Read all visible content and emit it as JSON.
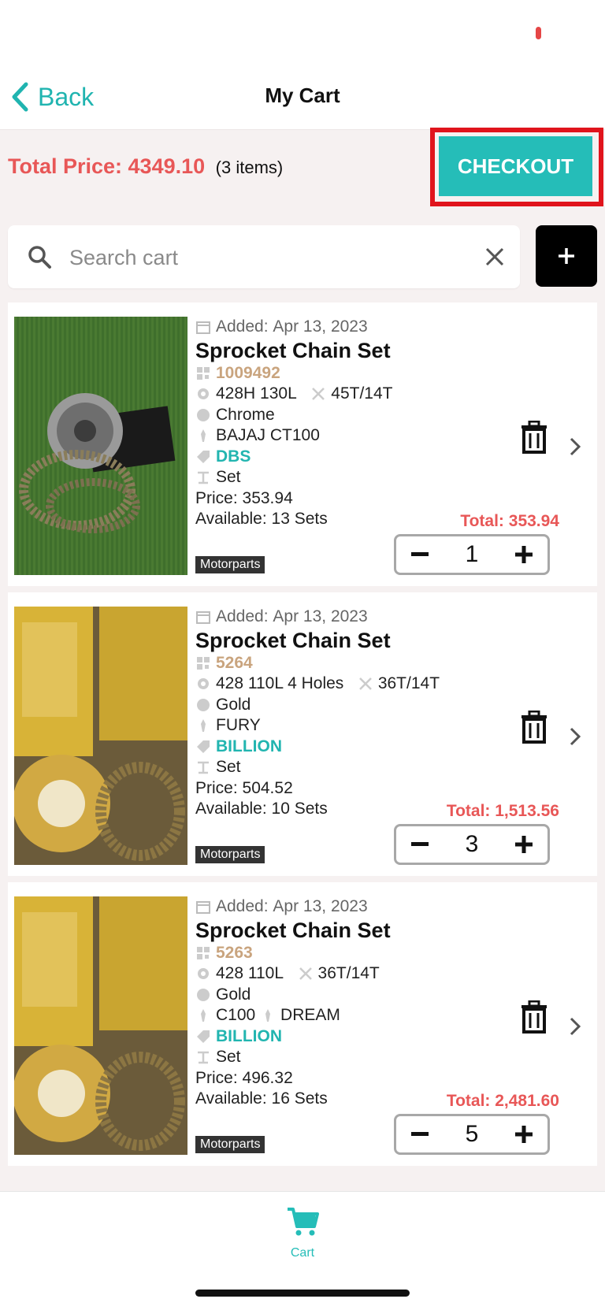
{
  "nav": {
    "back_label": "Back",
    "title": "My Cart"
  },
  "summary": {
    "total_label": "Total Price: 4349.10",
    "items_count": "(3 items)",
    "checkout_label": "CHECKOUT"
  },
  "search": {
    "placeholder": "Search cart",
    "value": ""
  },
  "items": [
    {
      "added_label": "Added:",
      "added_date": "Apr 13, 2023",
      "title": "Sprocket Chain Set",
      "code": "1009492",
      "spec": "428H 130L",
      "teeth": "45T/14T",
      "color": "Chrome",
      "models": [
        "BAJAJ CT100"
      ],
      "brand": "DBS",
      "unit": "Set",
      "price": "Price: 353.94",
      "available": "Available: 13 Sets",
      "total": "Total: 353.94",
      "qty": "1",
      "category": "Motorparts"
    },
    {
      "added_label": "Added:",
      "added_date": "Apr 13, 2023",
      "title": "Sprocket Chain Set",
      "code": "5264",
      "spec": "428 110L 4 Holes",
      "teeth": "36T/14T",
      "color": "Gold",
      "models": [
        "FURY"
      ],
      "brand": "BILLION",
      "unit": "Set",
      "price": "Price: 504.52",
      "available": "Available: 10 Sets",
      "total": "Total: 1,513.56",
      "qty": "3",
      "category": "Motorparts"
    },
    {
      "added_label": "Added:",
      "added_date": "Apr 13, 2023",
      "title": "Sprocket Chain Set",
      "code": "5263",
      "spec": "428 110L",
      "teeth": "36T/14T",
      "color": "Gold",
      "models": [
        "C100",
        "DREAM"
      ],
      "brand": "BILLION",
      "unit": "Set",
      "price": "Price: 496.32",
      "available": "Available: 16 Sets",
      "total": "Total: 2,481.60",
      "qty": "5",
      "category": "Motorparts"
    }
  ],
  "tabbar": {
    "cart_label": "Cart"
  },
  "colors": {
    "accent": "#25bdb8",
    "price_red": "#e85757",
    "code_gold": "#c9a47e",
    "highlight": "#e0141c"
  }
}
